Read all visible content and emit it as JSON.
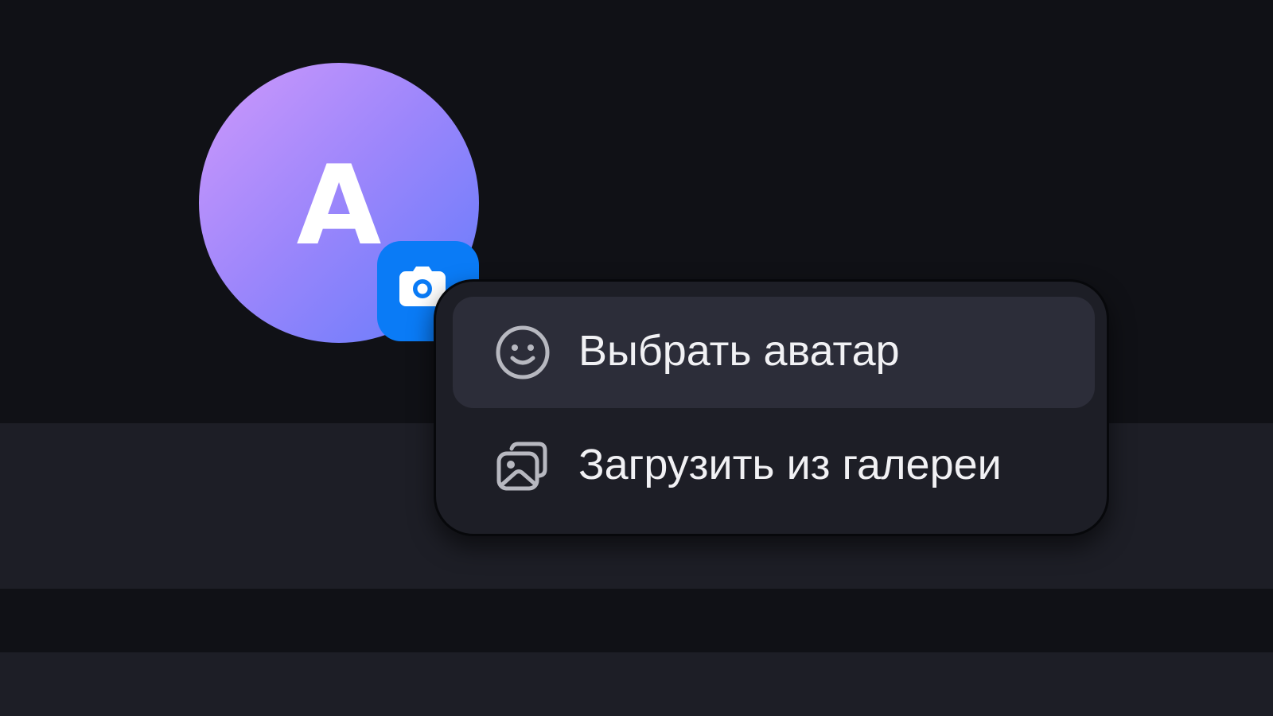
{
  "profile": {
    "avatar_initial": "A",
    "avatar_gradient": [
      "#cf99fb",
      "#627bfb"
    ],
    "camera_button_icon": "camera-icon",
    "camera_button_color": "#0a7bf6"
  },
  "avatar_menu": {
    "items": [
      {
        "label": "Выбрать аватар",
        "icon": "smiley-icon",
        "highlighted": true
      },
      {
        "label": "Загрузить из галереи",
        "icon": "gallery-icon",
        "highlighted": false
      }
    ]
  },
  "colors": {
    "background": "#101116",
    "panel": "#1d1e26",
    "menu_highlight": "#2c2d39",
    "text": "#f1f1f4"
  }
}
